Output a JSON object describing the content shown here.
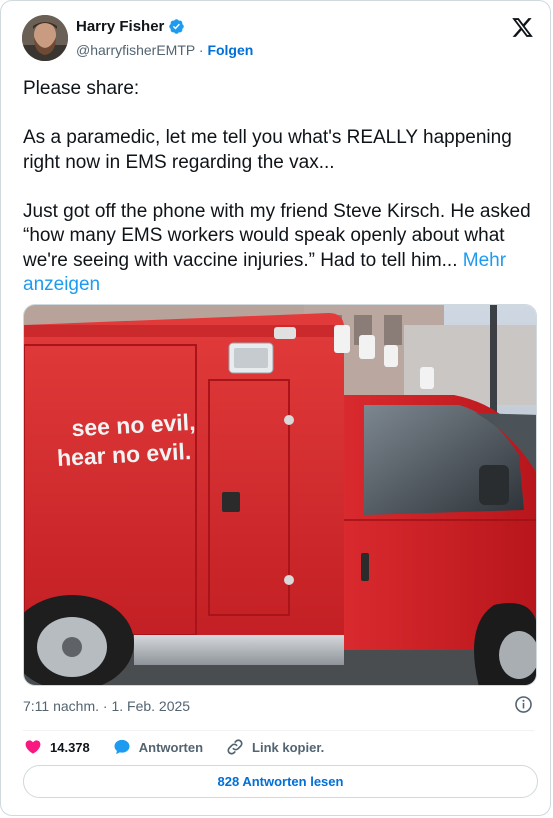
{
  "author": {
    "name": "Harry Fisher",
    "handle": "@harryfisherEMTP",
    "separator": "·",
    "follow_label": "Folgen"
  },
  "tweet": {
    "text": "Please share:\n\nAs a paramedic, let me tell you what's REALLY happening right now in EMS regarding the vax...\n\nJust got off the phone with my friend Steve Kirsch. He asked “how many EMS workers would speak openly about what we're seeing with vaccine injuries.” Had to tell him... ",
    "more_label": "Mehr anzeigen"
  },
  "image": {
    "van_text_line1": "see no evil,",
    "van_text_line2": "hear no evil."
  },
  "meta": {
    "timestamp": "7:11 nachm. · 1. Feb. 2025"
  },
  "actions": {
    "like_count": "14.378",
    "reply_label": "Antworten",
    "copy_link_label": "Link kopier."
  },
  "read_replies_label": "828 Antworten lesen",
  "icons": {
    "verified": "verified-badge-icon",
    "logo": "x-logo-icon",
    "info": "info-icon",
    "like": "heart-icon",
    "reply": "speech-bubble-icon",
    "link": "link-icon"
  },
  "colors": {
    "accent": "#1d9bf0",
    "link_blue": "#006fd6",
    "like_pink": "#f91880",
    "muted": "#536471"
  }
}
